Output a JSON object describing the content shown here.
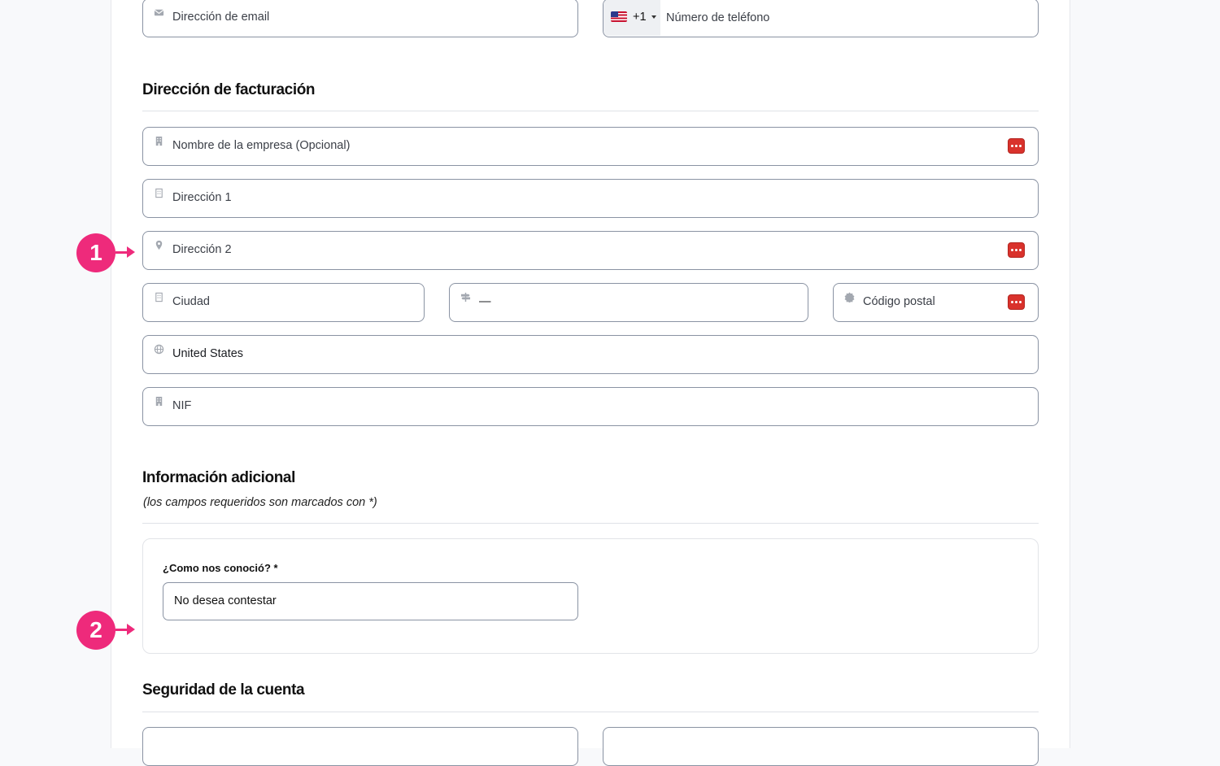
{
  "contact": {
    "email_placeholder": "Dirección de email",
    "phone_dial_code": "+1",
    "phone_placeholder": "Número de teléfono",
    "email_icon": "envelope-icon",
    "flag_icon": "us-flag-icon"
  },
  "billing": {
    "title": "Dirección de facturación",
    "company_placeholder": "Nombre de la empresa (Opcional)",
    "address1_placeholder": "Dirección 1",
    "address2_placeholder": "Dirección 2",
    "city_placeholder": "Ciudad",
    "state_value": "—",
    "postal_placeholder": "Código postal",
    "country_value": "United States",
    "nif_placeholder": "NIF"
  },
  "additional": {
    "title": "Información adicional",
    "note": "(los campos requeridos son marcados con *)",
    "question_label": "¿Como nos conoció? *",
    "question_value": "No desea contestar"
  },
  "security": {
    "title": "Seguridad de la cuenta"
  },
  "markers": [
    "1",
    "2"
  ],
  "colors": {
    "marker": "#ee2a7b",
    "password_manager": "#d9322c",
    "field_border": "#8a93a3"
  }
}
